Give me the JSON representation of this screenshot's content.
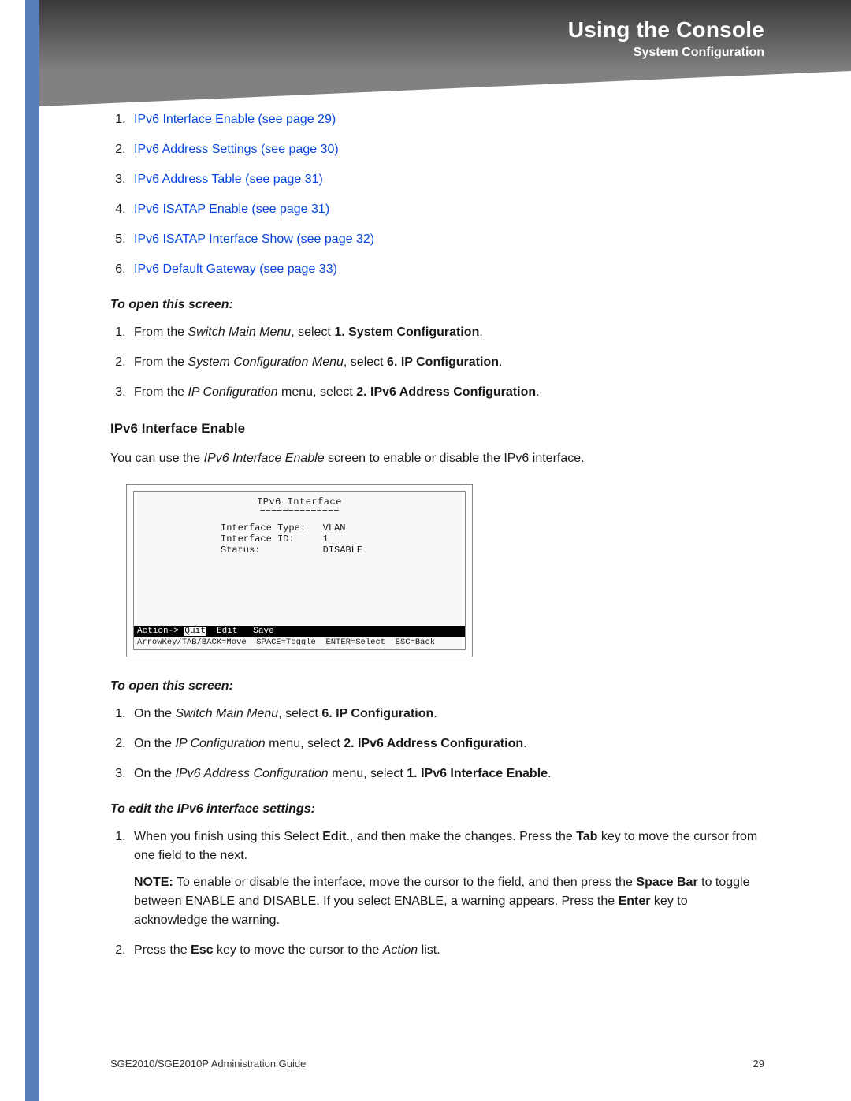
{
  "header": {
    "title": "Using the Console",
    "subtitle": "System Configuration"
  },
  "toc": [
    {
      "num": "1.",
      "text": "IPv6 Interface Enable (see page 29)"
    },
    {
      "num": "2.",
      "text": "IPv6 Address Settings (see page 30)"
    },
    {
      "num": "3.",
      "text": "IPv6 Address Table (see page 31)"
    },
    {
      "num": "4.",
      "text": "IPv6 ISATAP Enable (see page 31)"
    },
    {
      "num": "5.",
      "text": "IPv6 ISATAP Interface Show (see page 32)"
    },
    {
      "num": "6.",
      "text": "IPv6 Default Gateway (see page 33)"
    }
  ],
  "open1": {
    "heading": "To open this screen:",
    "steps": {
      "s1a": "From the ",
      "s1b": "Switch Main Menu",
      "s1c": ", select ",
      "s1d": "1. System Configuration",
      "s1e": ".",
      "s2a": "From the ",
      "s2b": "System Configuration Menu",
      "s2c": ", select ",
      "s2d": "6. IP Configuration",
      "s2e": ".",
      "s3a": "From the ",
      "s3b": "IP Configuration",
      "s3c": " menu, select ",
      "s3d": "2. IPv6 Address Configuration",
      "s3e": "."
    }
  },
  "section": {
    "title": "IPv6 Interface Enable",
    "introA": "You can use the ",
    "introB": "IPv6 Interface Enable",
    "introC": " screen to enable or disable the IPv6 interface."
  },
  "console": {
    "title": "IPv6 Interface",
    "underline": "==============",
    "row1": "Interface Type:   VLAN",
    "row2": "Interface ID:     1",
    "row3": "Status:           DISABLE",
    "actionPrefix": "Action-> ",
    "actionQuit": "Quit",
    "actionRest": "  Edit   Save",
    "help": "ArrowKey/TAB/BACK=Move  SPACE=Toggle  ENTER=Select  ESC=Back"
  },
  "open2": {
    "heading": "To open this screen:",
    "steps": {
      "s1a": "On the ",
      "s1b": "Switch Main Menu",
      "s1c": ", select ",
      "s1d": "6. IP Configuration",
      "s1e": ".",
      "s2a": "On the ",
      "s2b": "IP Configuration",
      "s2c": " menu, select ",
      "s2d": "2. IPv6 Address Configuration",
      "s2e": ".",
      "s3a": "On the ",
      "s3b": "IPv6 Address Configuration",
      "s3c": " menu, select ",
      "s3d": "1. IPv6 Interface Enable",
      "s3e": "."
    }
  },
  "edit": {
    "heading": "To edit the IPv6 interface settings:",
    "s1a": "When you finish using this Select ",
    "s1b": "Edit",
    "s1c": "., and then make the changes. Press the ",
    "s1d": "Tab",
    "s1e": " key to move the cursor from one field to the next.",
    "noteLabel": "NOTE:",
    "noteA": " To enable or disable the interface, move the cursor to the field, and then press the ",
    "noteB": "Space Bar",
    "noteC": " to toggle between ENABLE and DISABLE. If you select ENABLE, a warning appears. Press the ",
    "noteD": "Enter",
    "noteE": " key to acknowledge the warning.",
    "s2a": "Press the ",
    "s2b": "Esc",
    "s2c": " key to move the cursor to the ",
    "s2d": "Action",
    "s2e": " list."
  },
  "footer": {
    "left": "SGE2010/SGE2010P Administration Guide",
    "right": "29"
  }
}
